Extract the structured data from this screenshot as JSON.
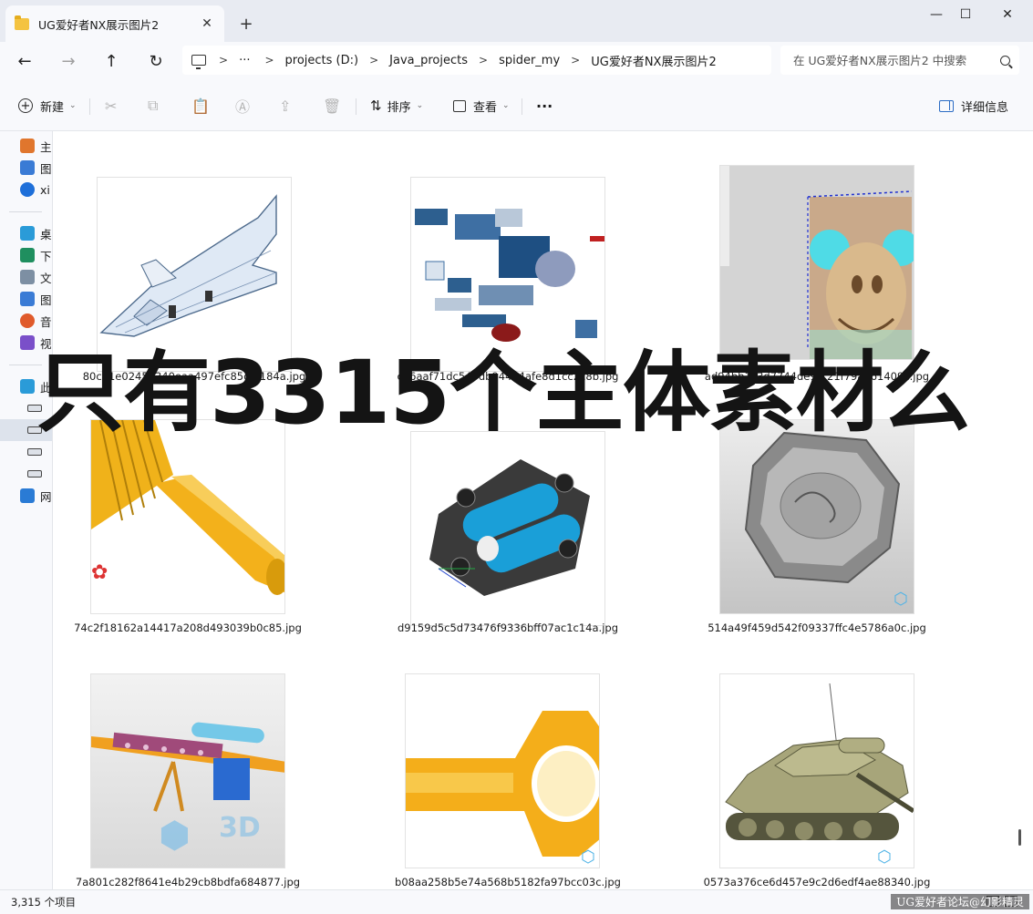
{
  "window": {
    "tab_title": "UG爱好者NX展示图片2",
    "tab_close": "✕",
    "new_tab": "+",
    "minimize": "—",
    "maximize": "☐",
    "close": "✕"
  },
  "nav": {
    "back": "←",
    "forward": "→",
    "up": "↑",
    "refresh": "↻"
  },
  "breadcrumb": {
    "more": "···",
    "items": [
      "projects (D:)",
      "Java_projects",
      "spider_my",
      "UG爱好者NX展示图片2"
    ],
    "sep": ">"
  },
  "search": {
    "placeholder": "在 UG爱好者NX展示图片2 中搜索"
  },
  "toolbar": {
    "new_label": "新建",
    "sort_label": "排序",
    "view_label": "查看",
    "more": "···",
    "details_label": "详细信息",
    "cut": "✂",
    "copy": "⧉",
    "paste": "📋",
    "rename": "Ⓐ",
    "share": "⇪",
    "delete": "🗑"
  },
  "sidebar": {
    "items": [
      {
        "label": "主",
        "icon": "home-icon",
        "color": "#e0762d"
      },
      {
        "label": "图",
        "icon": "gallery-icon",
        "color": "#3a7bd5"
      },
      {
        "label": "xi",
        "icon": "cloud-icon",
        "color": "#1e6fd9"
      },
      {
        "label": "桌",
        "icon": "desktop-icon",
        "color": "#2a9bd8"
      },
      {
        "label": "下",
        "icon": "download-icon",
        "color": "#1f8f5f"
      },
      {
        "label": "文",
        "icon": "document-icon",
        "color": "#7d8fa3"
      },
      {
        "label": "图",
        "icon": "pictures-icon",
        "color": "#3a7bd5"
      },
      {
        "label": "音",
        "icon": "music-icon",
        "color": "#e05a2b"
      },
      {
        "label": "视",
        "icon": "video-icon",
        "color": "#7a4fc9"
      },
      {
        "label": "此",
        "icon": "this-pc-icon",
        "color": "#2a9bd8"
      },
      {
        "label": "网",
        "icon": "network-icon",
        "color": "#2a7bd5"
      }
    ]
  },
  "files": [
    {
      "name": "80c41e02454340eaa497efc85cf8184a.jpg",
      "icon": "jet-fighter-image"
    },
    {
      "name": "c06aaf71dc545db94454afe8d1cc2c8b.jpg",
      "icon": "exploded-assembly-image"
    },
    {
      "name": "ad94bb1c3d7744de9f121f79a061409c.jpg",
      "icon": "mickey-mold-image"
    },
    {
      "name": "74c2f18162a14417a208d493039b0c85.jpg",
      "icon": "gear-shaft-image"
    },
    {
      "name": "d9159d5c5d73476f9336bff07ac1c14a.jpg",
      "icon": "underwater-robot-image"
    },
    {
      "name": "514a49f459d542f09337ffc4e5786a0c.jpg",
      "icon": "ashtray-image"
    },
    {
      "name": "7a801c282f8641e4b29cb8bdfa684877.jpg",
      "icon": "sniper-rifle-image"
    },
    {
      "name": "b08aa258b5e74a568b5182fa97bcc03c.jpg",
      "icon": "wrench-image"
    },
    {
      "name": "0573a376ce6d457e9c2d6edf4ae88340.jpg",
      "icon": "tank-image"
    }
  ],
  "overlay_text": "只有3315个主体素材么",
  "status": {
    "count": "3,315 个项目",
    "watermark": "UG爱好者论坛@幻影精灵"
  },
  "thumb_text": {
    "brand": "3D"
  }
}
